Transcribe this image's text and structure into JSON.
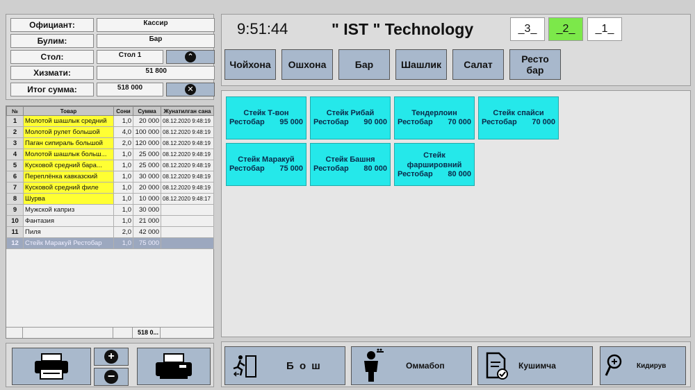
{
  "info": {
    "waiter_label": "Официант:",
    "waiter_value": "Кассир",
    "section_label": "Булим:",
    "section_value": "Бар",
    "table_label": "Стол:",
    "table_value": "Стол 1",
    "service_label": "Хизмати:",
    "service_value": "51 800",
    "total_label": "Итог сумма:",
    "total_value": "518 000"
  },
  "order": {
    "columns": [
      "№",
      "Товар",
      "Сони",
      "Сумма",
      "Жунатилган сана"
    ],
    "rows": [
      {
        "n": "1",
        "name": "Молотой шашлык средний",
        "qty": "1,0",
        "sum": "20 000",
        "date": "08.12.2020 9:48:19",
        "highlight": true
      },
      {
        "n": "2",
        "name": "Молотой рулет большой",
        "qty": "4,0",
        "sum": "100 000",
        "date": "08.12.2020 9:48:19",
        "highlight": true
      },
      {
        "n": "3",
        "name": "Паган сипираль большой",
        "qty": "2,0",
        "sum": "120 000",
        "date": "08.12.2020 9:48:19",
        "highlight": true
      },
      {
        "n": "4",
        "name": "Молотой шашлык больш...",
        "qty": "1,0",
        "sum": "25 000",
        "date": "08.12.2020 9:48:19",
        "highlight": true
      },
      {
        "n": "5",
        "name": "Кусковой средний бара...",
        "qty": "1,0",
        "sum": "25 000",
        "date": "08.12.2020 9:48:19",
        "highlight": true
      },
      {
        "n": "6",
        "name": "Переплёнка кавказский",
        "qty": "1,0",
        "sum": "30 000",
        "date": "08.12.2020 9:48:19",
        "highlight": true
      },
      {
        "n": "7",
        "name": "Кусковой средний филе",
        "qty": "1,0",
        "sum": "20 000",
        "date": "08.12.2020 9:48:19",
        "highlight": true
      },
      {
        "n": "8",
        "name": "Шурва",
        "qty": "1,0",
        "sum": "10 000",
        "date": "08.12.2020 9:48:17",
        "highlight": true
      },
      {
        "n": "9",
        "name": "Мужской каприз",
        "qty": "1,0",
        "sum": "30 000",
        "date": "",
        "highlight": false
      },
      {
        "n": "10",
        "name": "Фантазия",
        "qty": "1,0",
        "sum": "21 000",
        "date": "",
        "highlight": false
      },
      {
        "n": "11",
        "name": "Пиля",
        "qty": "2,0",
        "sum": "42 000",
        "date": "",
        "highlight": false
      },
      {
        "n": "12",
        "name": "Стейк Маракуй Рестобар",
        "qty": "1,0",
        "sum": "75 000",
        "date": "",
        "highlight": false,
        "selected": true
      }
    ],
    "total": "518 0..."
  },
  "header": {
    "clock": "9:51:44",
    "brand": "\" IST \" Technology",
    "pages": [
      {
        "label": "_3_",
        "active": false
      },
      {
        "label": "_2_",
        "active": true
      },
      {
        "label": "_1_",
        "active": false
      }
    ],
    "categories": [
      "Чойхона",
      "Ошхона",
      "Бар",
      "Шашлик",
      "Салат",
      "Ресто\nбар"
    ]
  },
  "items": [
    {
      "name": "Стейк Т-вон",
      "loc": "Рестобар",
      "price": "95 000"
    },
    {
      "name": "Стейк Рибай",
      "loc": "Рестобар",
      "price": "90 000"
    },
    {
      "name": "Тендерлоин",
      "loc": "Рестобар",
      "price": "70 000"
    },
    {
      "name": "Стейк спайси",
      "loc": "Рестобар",
      "price": "70 000"
    },
    {
      "name": "Стейк Маракуй",
      "loc": "Рестобар",
      "price": "75 000"
    },
    {
      "name": "Стейк Башня",
      "loc": "Рестобар",
      "price": "80 000"
    },
    {
      "name": "Стейк\nфаршировний",
      "loc": "Рестобар",
      "price": "80 000"
    }
  ],
  "actions": {
    "exit_label": "Б о ш",
    "popular_label": "Оммабоп",
    "extra_label": "Кушимча",
    "search_label": "Кидирув"
  },
  "colors": {
    "accent_button": "#a8b8cc",
    "item_bg": "#25e8ea",
    "highlight_row": "#ffff33",
    "active_page": "#7ce84a"
  }
}
